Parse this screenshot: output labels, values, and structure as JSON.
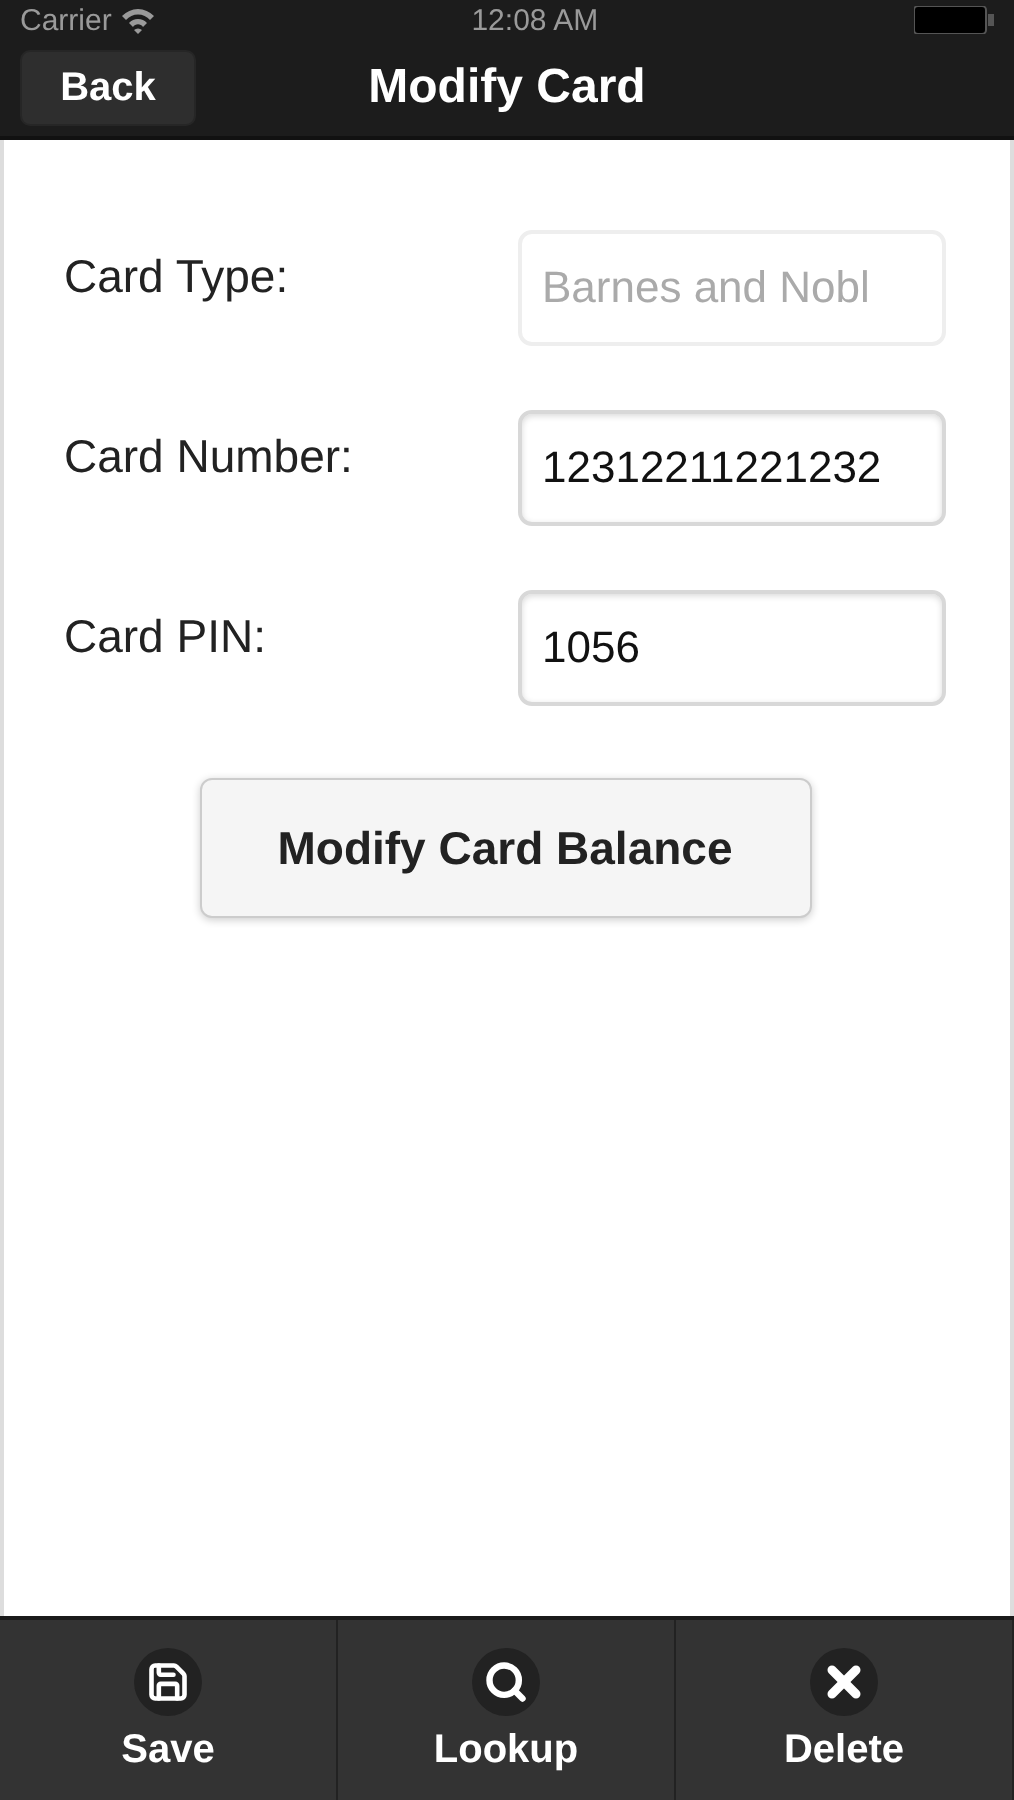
{
  "status_bar": {
    "carrier": "Carrier",
    "time": "12:08 AM"
  },
  "header": {
    "back": "Back",
    "title": "Modify Card"
  },
  "fields": [
    {
      "label": "Card Type:",
      "value": "Barnes and Nobl",
      "disabled": true
    },
    {
      "label": "Card Number:",
      "value": "12312211221232",
      "disabled": false
    },
    {
      "label": "Card PIN:",
      "value": "1056",
      "disabled": false
    }
  ],
  "action_button": "Modify Card Balance",
  "footer": [
    {
      "kind": "save",
      "label": "Save"
    },
    {
      "kind": "search",
      "label": "Lookup"
    },
    {
      "kind": "delete",
      "label": "Delete"
    }
  ]
}
